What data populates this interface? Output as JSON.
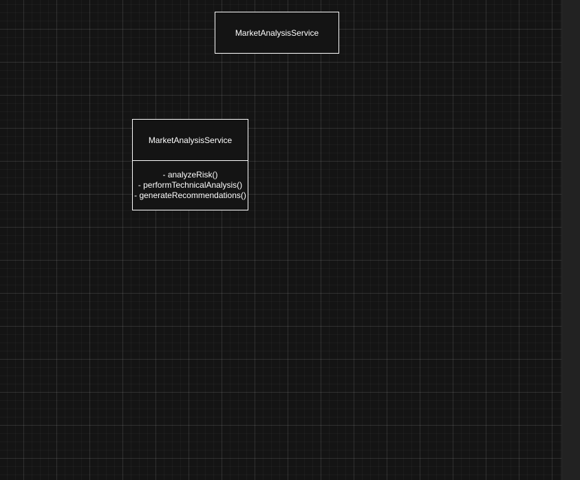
{
  "canvas": {
    "background": "#141414",
    "grid": true
  },
  "diagram": {
    "top_shape": {
      "label": "MarketAnalysisService"
    },
    "class_shape": {
      "name": "MarketAnalysisService",
      "methods": [
        "- analyzeRisk()",
        "- performTechnicalAnalysis()",
        "- generateRecommendations()"
      ]
    },
    "stroke_color": "#ffffff",
    "text_color": "#ffffff"
  }
}
